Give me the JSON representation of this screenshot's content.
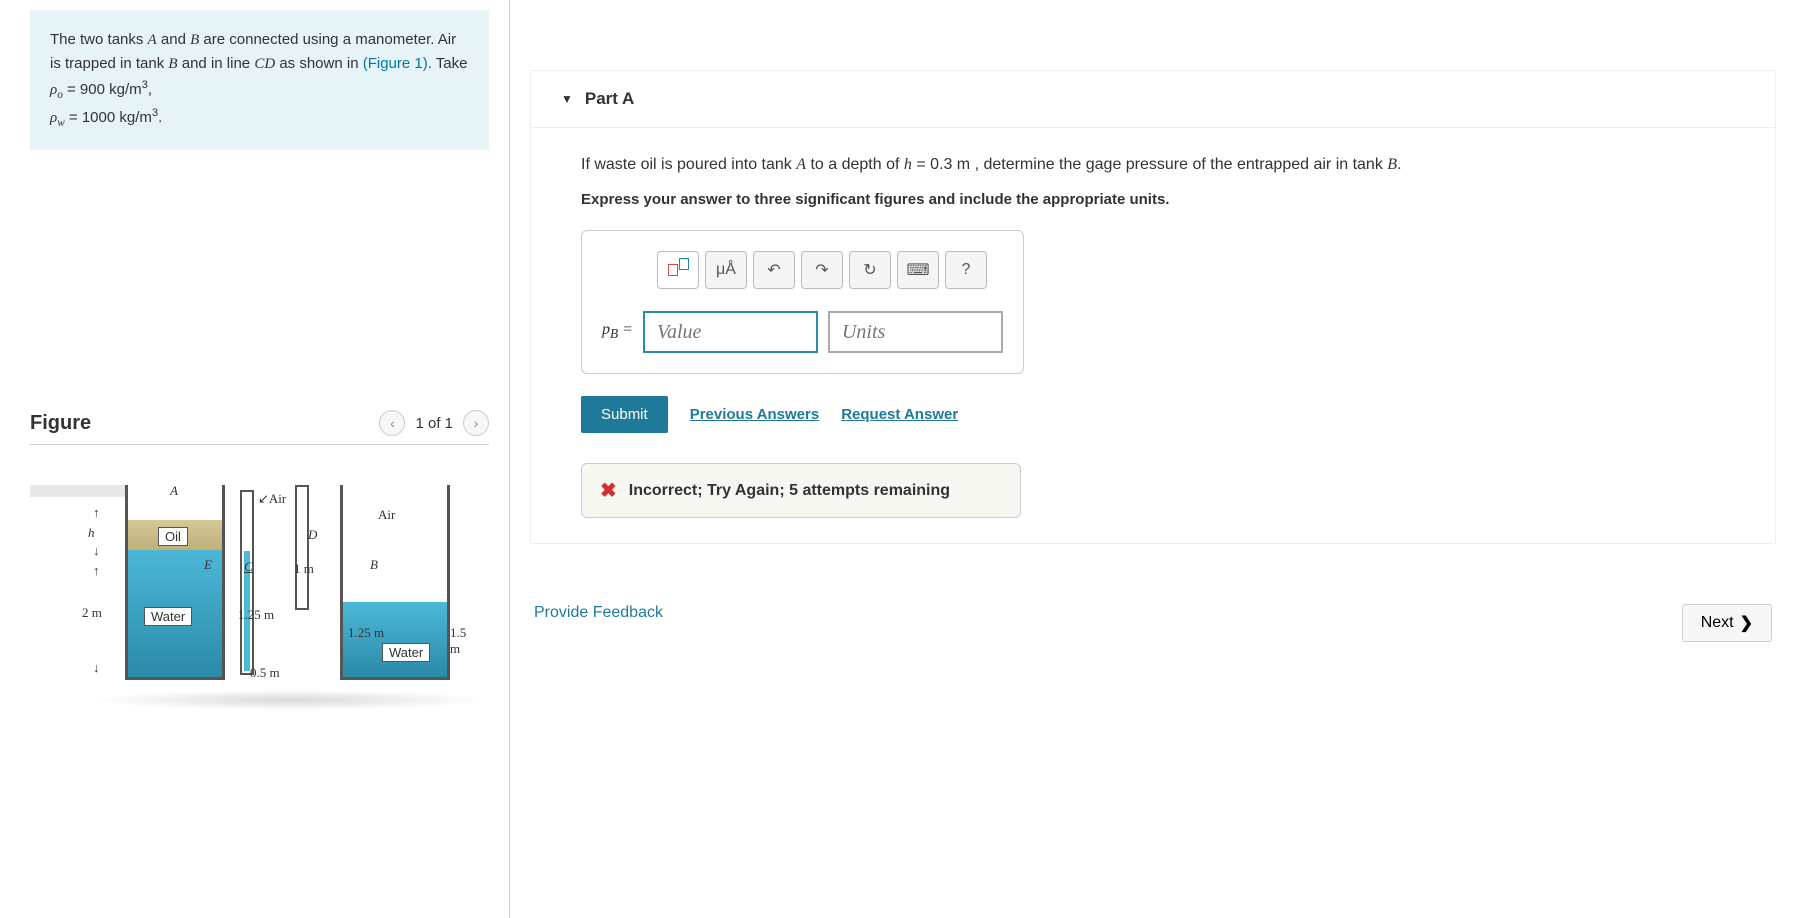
{
  "problem": {
    "line1_a": "The two tanks ",
    "var_A": "A",
    "line1_b": " and ",
    "var_B": "B",
    "line1_c": " are connected using a manometer. Air is trapped in tank ",
    "line1_d": " and in line ",
    "var_CD": "CD",
    "line1_e": " as shown in ",
    "fig_link": "(Figure 1)",
    "line1_f": ". Take ",
    "rho_o": "ρ",
    "rho_o_sub": "o",
    "rho_o_val": " = 900 kg/m",
    "sup3": "3",
    "comma": ",",
    "rho_w": "ρ",
    "rho_w_sub": "w",
    "rho_w_val": " = 1000 kg/m",
    "period": "."
  },
  "figure": {
    "title": "Figure",
    "nav_label": "1 of 1",
    "labels": {
      "A": "A",
      "B": "B",
      "C": "C",
      "D": "D",
      "E": "E",
      "h": "h",
      "Oil": "Oil",
      "Water": "Water",
      "Air": "Air",
      "dim_2m": "2 m",
      "dim_1m": "1 m",
      "dim_125m_a": "1.25 m",
      "dim_125m_b": "1.25 m",
      "dim_05m": "0.5 m",
      "dim_15m": "1.5 m"
    }
  },
  "part": {
    "title": "Part A",
    "q1": "If waste oil is poured into tank ",
    "q_A": "A",
    "q2": " to a depth of ",
    "q_h": "h",
    "q3": " = 0.3  m , determine the gage pressure of the entrapped air in tank ",
    "q_B": "B",
    "q4": ".",
    "instruction": "Express your answer to three significant figures and include the appropriate units.",
    "toolbar": {
      "units_btn": "μÅ",
      "help": "?"
    },
    "answer": {
      "label_var": "p",
      "label_sub": "B",
      "label_eq": " =",
      "value_placeholder": "Value",
      "units_placeholder": "Units"
    },
    "submit": "Submit",
    "prev_answers": "Previous Answers",
    "request_answer": "Request Answer",
    "feedback": "Incorrect; Try Again; 5 attempts remaining"
  },
  "footer": {
    "provide_feedback": "Provide Feedback",
    "next": "Next"
  }
}
